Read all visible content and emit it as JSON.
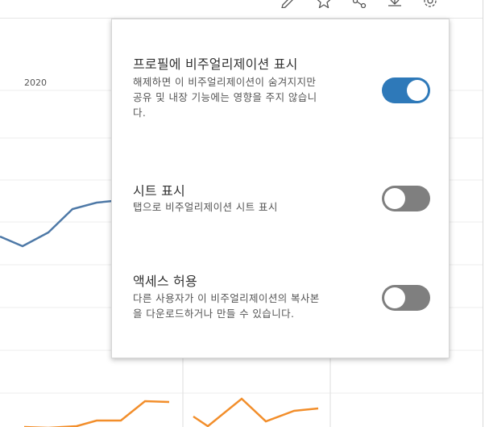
{
  "toolbar": {
    "icons": [
      "edit-icon",
      "star-icon",
      "share-icon",
      "download-icon",
      "settings-gear-icon"
    ]
  },
  "background": {
    "year_label": "2020",
    "colors": {
      "blue_line": "#4e79a7",
      "orange_line": "#f28e2b"
    }
  },
  "settings": {
    "accent_color": "#2e79b9",
    "options": [
      {
        "title": "프로필에 비주얼리제이션 표시",
        "desc_lines": [
          "해제하면 이 비주얼리제이션이 숨겨지지만",
          "공유 및 내장 기능에는 영향을 주지 않습니",
          "다."
        ],
        "enabled": true
      },
      {
        "title": "시트 표시",
        "desc_lines": [
          "탭으로 비주얼리제이션 시트 표시"
        ],
        "enabled": false
      },
      {
        "title": "액세스 허용",
        "desc_lines": [
          "다른 사용자가 이 비주얼리제이션의 복사본",
          "을 다운로드하거나 만들 수 있습니다."
        ],
        "enabled": false
      }
    ]
  }
}
